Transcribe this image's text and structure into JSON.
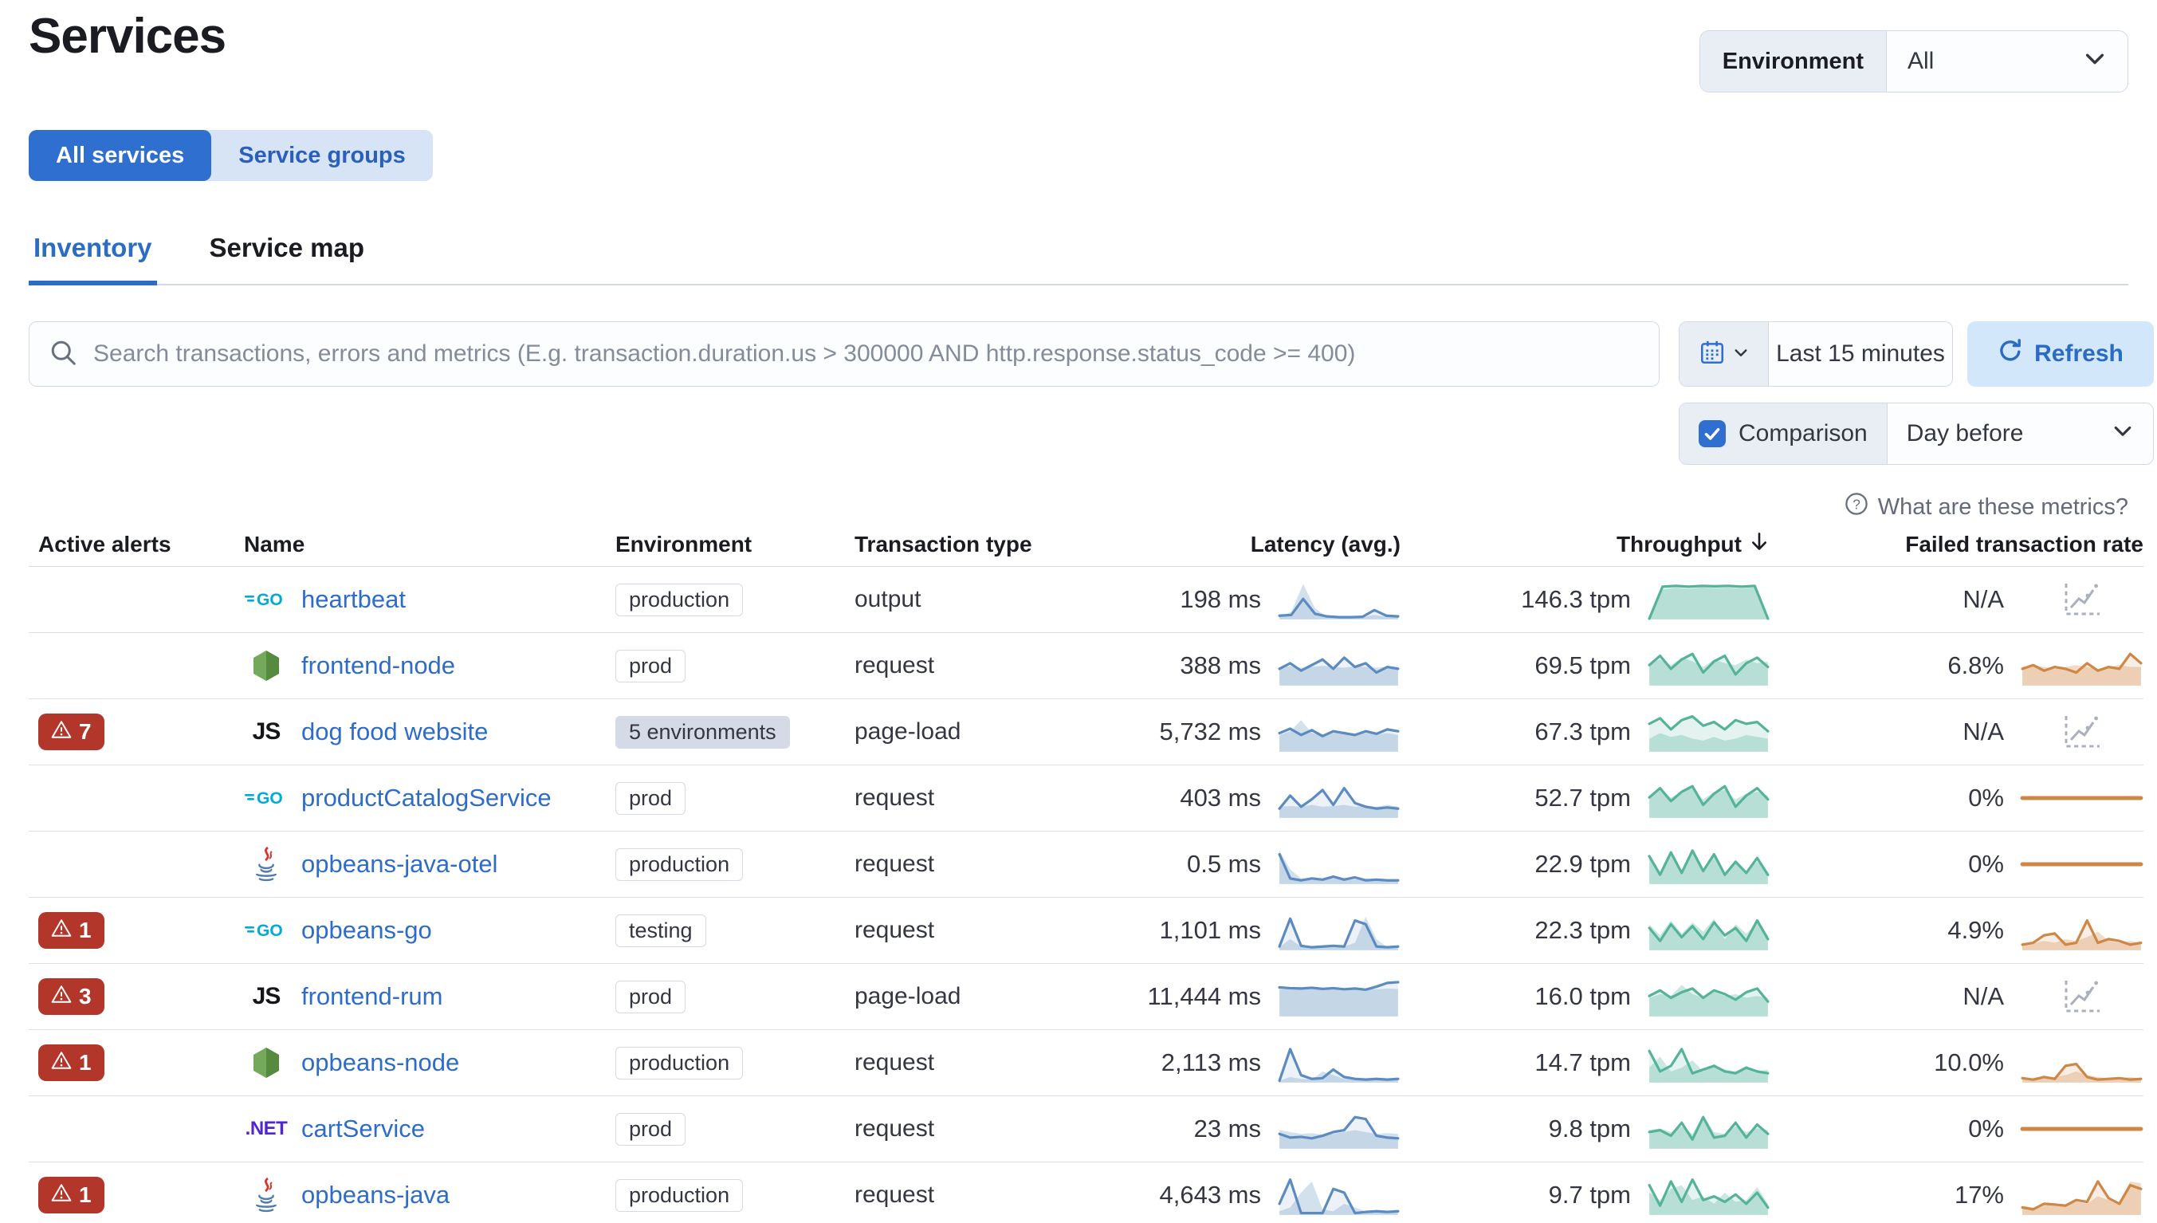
{
  "page": {
    "title": "Services"
  },
  "env_filter": {
    "label": "Environment",
    "value": "All"
  },
  "toggle": {
    "all_services": "All services",
    "service_groups": "Service groups",
    "selected": "All services"
  },
  "tabs": [
    {
      "label": "Inventory",
      "active": true
    },
    {
      "label": "Service map",
      "active": false
    }
  ],
  "search": {
    "placeholder": "Search transactions, errors and metrics (E.g. transaction.duration.us > 300000 AND http.response.status_code >= 400)"
  },
  "time_picker": {
    "range": "Last 15 minutes",
    "refresh_label": "Refresh"
  },
  "comparison": {
    "label": "Comparison",
    "checked": true,
    "value": "Day before"
  },
  "help": {
    "label": "What are these metrics?"
  },
  "table": {
    "headers": {
      "alerts": "Active alerts",
      "name": "Name",
      "environment": "Environment",
      "transaction_type": "Transaction type",
      "latency": "Latency (avg.)",
      "throughput": "Throughput",
      "failed": "Failed transaction rate"
    },
    "sorted_by": "throughput",
    "sort_direction": "desc"
  },
  "colors": {
    "primary": "#2e6fd0",
    "link": "#2e6cc9",
    "alert_badge": "#b3362a",
    "latency_line": "#5b8bc0",
    "latency_fill": "rgba(96,146,192,0.12)",
    "latency_comp_fill": "rgba(96,146,192,0.28)",
    "throughput_line": "#54b399",
    "throughput_fill": "rgba(84,179,153,0.16)",
    "throughput_comp_fill": "rgba(84,179,153,0.30)",
    "failed_line": "#cf8745",
    "failed_fill": "rgba(207,135,69,0.14)",
    "failed_comp_fill": "rgba(207,135,69,0.30)"
  },
  "rows": [
    {
      "alerts": null,
      "icon": "go",
      "name": "heartbeat",
      "environment": "production",
      "badge_style": "outline",
      "type": "output",
      "latency": "198 ms",
      "throughput": "146.3 tpm",
      "failed": "N/A",
      "sparks": {
        "latency": {
          "cur": [
            0.1,
            0.12,
            0.55,
            0.15,
            0.08,
            0.06,
            0.06,
            0.07,
            0.25,
            0.1,
            0.08
          ],
          "cmp": [
            0.08,
            0.2,
            0.95,
            0.3,
            0.07,
            0.05,
            0.05,
            0.06,
            0.12,
            0.07,
            0.05
          ]
        },
        "throughput": {
          "cur": [
            0.02,
            0.88,
            0.9,
            0.88,
            0.9,
            0.89,
            0.9,
            0.88,
            0.9,
            0.02
          ],
          "cmp": [
            0.02,
            0.8,
            0.85,
            0.82,
            0.86,
            0.84,
            0.85,
            0.83,
            0.86,
            0.02
          ]
        },
        "failed": null
      }
    },
    {
      "alerts": null,
      "icon": "node",
      "name": "frontend-node",
      "environment": "prod",
      "badge_style": "outline",
      "type": "request",
      "latency": "388 ms",
      "throughput": "69.5 tpm",
      "failed": "6.8%",
      "sparks": {
        "latency": {
          "cur": [
            0.45,
            0.6,
            0.4,
            0.55,
            0.7,
            0.45,
            0.75,
            0.5,
            0.6,
            0.35,
            0.5,
            0.45
          ],
          "cmp": [
            0.5,
            0.52,
            0.48,
            0.5,
            0.53,
            0.5,
            0.48,
            0.52,
            0.5,
            0.48,
            0.5,
            0.5
          ]
        },
        "throughput": {
          "cur": [
            0.55,
            0.8,
            0.45,
            0.7,
            0.85,
            0.35,
            0.65,
            0.8,
            0.3,
            0.6,
            0.75,
            0.5
          ],
          "cmp": [
            0.6,
            0.7,
            0.55,
            0.75,
            0.65,
            0.5,
            0.7,
            0.6,
            0.55,
            0.7,
            0.6,
            0.65
          ]
        },
        "failed": {
          "cur": [
            0.45,
            0.55,
            0.4,
            0.5,
            0.45,
            0.35,
            0.6,
            0.4,
            0.5,
            0.45,
            0.85,
            0.6
          ],
          "cmp": [
            0.5,
            0.55,
            0.5,
            0.45,
            0.5,
            0.55,
            0.5,
            0.45,
            0.5,
            0.55,
            0.5,
            0.5
          ]
        }
      }
    },
    {
      "alerts": 7,
      "icon": "js",
      "name": "dog food website",
      "environment": "5 environments",
      "badge_style": "filled",
      "type": "page-load",
      "latency": "5,732 ms",
      "throughput": "67.3 tpm",
      "failed": "N/A",
      "sparks": {
        "latency": {
          "cur": [
            0.5,
            0.62,
            0.45,
            0.58,
            0.42,
            0.55,
            0.5,
            0.45,
            0.55,
            0.48,
            0.6,
            0.55
          ],
          "cmp": [
            0.45,
            0.55,
            0.85,
            0.5,
            0.45,
            0.5,
            0.55,
            0.45,
            0.5,
            0.45,
            0.5,
            0.45
          ]
        },
        "throughput": {
          "cur": [
            0.75,
            0.9,
            0.6,
            0.85,
            0.95,
            0.7,
            0.8,
            0.6,
            0.85,
            0.75,
            0.8,
            0.55
          ],
          "cmp": [
            0.35,
            0.5,
            0.4,
            0.45,
            0.35,
            0.3,
            0.4,
            0.3,
            0.35,
            0.45,
            0.4,
            0.35
          ]
        },
        "failed": null
      }
    },
    {
      "alerts": null,
      "icon": "go",
      "name": "productCatalogService",
      "environment": "prod",
      "badge_style": "outline",
      "type": "request",
      "latency": "403 ms",
      "throughput": "52.7 tpm",
      "failed": "0%",
      "sparks": {
        "latency": {
          "cur": [
            0.25,
            0.6,
            0.3,
            0.5,
            0.75,
            0.35,
            0.8,
            0.4,
            0.3,
            0.25,
            0.28,
            0.25
          ],
          "cmp": [
            0.3,
            0.32,
            0.3,
            0.35,
            0.3,
            0.32,
            0.35,
            0.3,
            0.32,
            0.3,
            0.35,
            0.3
          ]
        },
        "throughput": {
          "cur": [
            0.55,
            0.8,
            0.45,
            0.7,
            0.85,
            0.35,
            0.65,
            0.85,
            0.3,
            0.6,
            0.8,
            0.5
          ],
          "cmp": [
            0.6,
            0.75,
            0.55,
            0.7,
            0.8,
            0.5,
            0.7,
            0.75,
            0.5,
            0.65,
            0.7,
            0.6
          ]
        },
        "failed": {
          "flat": true
        }
      }
    },
    {
      "alerts": null,
      "icon": "java",
      "name": "opbeans-java-otel",
      "environment": "production",
      "badge_style": "outline",
      "type": "request",
      "latency": "0.5 ms",
      "throughput": "22.9 tpm",
      "failed": "0%",
      "sparks": {
        "latency": {
          "cur": [
            0.8,
            0.15,
            0.1,
            0.15,
            0.12,
            0.2,
            0.12,
            0.18,
            0.1,
            0.12,
            0.1,
            0.1
          ],
          "cmp": [
            0.9,
            0.4,
            0.15,
            0.1,
            0.12,
            0.15,
            0.1,
            0.12,
            0.15,
            0.1,
            0.12,
            0.1
          ]
        },
        "throughput": {
          "cur": [
            0.75,
            0.25,
            0.85,
            0.3,
            0.9,
            0.35,
            0.8,
            0.25,
            0.6,
            0.3,
            0.7,
            0.25
          ],
          "cmp": [
            0.8,
            0.3,
            0.8,
            0.35,
            0.85,
            0.3,
            0.75,
            0.3,
            0.65,
            0.35,
            0.6,
            0.3
          ]
        },
        "failed": {
          "flat": true
        }
      }
    },
    {
      "alerts": 1,
      "icon": "go",
      "name": "opbeans-go",
      "environment": "testing",
      "badge_style": "outline",
      "type": "request",
      "latency": "1,101 ms",
      "throughput": "22.3 tpm",
      "failed": "4.9%",
      "sparks": {
        "latency": {
          "cur": [
            0.1,
            0.85,
            0.12,
            0.08,
            0.1,
            0.12,
            0.1,
            0.8,
            0.7,
            0.1,
            0.08,
            0.1
          ],
          "cmp": [
            0.08,
            0.3,
            0.1,
            0.08,
            0.1,
            0.08,
            0.1,
            0.2,
            0.9,
            0.3,
            0.08,
            0.08
          ]
        },
        "throughput": {
          "cur": [
            0.6,
            0.25,
            0.7,
            0.35,
            0.65,
            0.3,
            0.75,
            0.4,
            0.6,
            0.25,
            0.8,
            0.3
          ],
          "cmp": [
            0.7,
            0.4,
            0.8,
            0.45,
            0.75,
            0.5,
            0.85,
            0.3,
            0.7,
            0.45,
            0.75,
            0.4
          ]
        },
        "failed": {
          "cur": [
            0.15,
            0.2,
            0.4,
            0.45,
            0.15,
            0.2,
            0.8,
            0.2,
            0.3,
            0.25,
            0.15,
            0.2
          ],
          "cmp": [
            0.2,
            0.18,
            0.25,
            0.2,
            0.3,
            0.25,
            0.35,
            0.5,
            0.25,
            0.2,
            0.25,
            0.2
          ]
        }
      }
    },
    {
      "alerts": 3,
      "icon": "js",
      "name": "frontend-rum",
      "environment": "prod",
      "badge_style": "outline",
      "type": "page-load",
      "latency": "11,444 ms",
      "throughput": "16.0 tpm",
      "failed": "N/A",
      "sparks": {
        "latency": {
          "cur": [
            0.78,
            0.76,
            0.75,
            0.77,
            0.74,
            0.76,
            0.73,
            0.75,
            0.72,
            0.8,
            0.9,
            0.92
          ],
          "cmp": [
            0.72,
            0.74,
            0.73,
            0.75,
            0.72,
            0.74,
            0.73,
            0.72,
            0.74,
            0.73,
            0.75,
            0.74
          ]
        },
        "throughput": {
          "cur": [
            0.55,
            0.7,
            0.5,
            0.65,
            0.75,
            0.5,
            0.7,
            0.6,
            0.45,
            0.65,
            0.75,
            0.4
          ],
          "cmp": [
            0.5,
            0.6,
            0.55,
            0.85,
            0.6,
            0.5,
            0.65,
            0.55,
            0.6,
            0.5,
            0.55,
            0.5
          ]
        },
        "failed": null
      }
    },
    {
      "alerts": 1,
      "icon": "node",
      "name": "opbeans-node",
      "environment": "production",
      "badge_style": "outline",
      "type": "request",
      "latency": "2,113 ms",
      "throughput": "14.7 tpm",
      "failed": "10.0%",
      "sparks": {
        "latency": {
          "cur": [
            0.05,
            0.9,
            0.2,
            0.1,
            0.12,
            0.35,
            0.15,
            0.1,
            0.08,
            0.1,
            0.08,
            0.1
          ],
          "cmp": [
            0.05,
            0.15,
            0.1,
            0.08,
            0.3,
            0.2,
            0.1,
            0.08,
            0.1,
            0.08,
            0.05,
            0.08
          ]
        },
        "throughput": {
          "cur": [
            0.85,
            0.3,
            0.45,
            0.9,
            0.25,
            0.35,
            0.45,
            0.3,
            0.25,
            0.4,
            0.3,
            0.25
          ],
          "cmp": [
            0.4,
            0.7,
            0.3,
            0.4,
            0.6,
            0.3,
            0.5,
            0.35,
            0.3,
            0.45,
            0.3,
            0.35
          ]
        },
        "failed": {
          "cur": [
            0.12,
            0.08,
            0.15,
            0.1,
            0.45,
            0.5,
            0.15,
            0.08,
            0.1,
            0.12,
            0.08,
            0.1
          ],
          "cmp": [
            0.1,
            0.12,
            0.1,
            0.15,
            0.2,
            0.3,
            0.2,
            0.15,
            0.1,
            0.12,
            0.15,
            0.1
          ]
        }
      }
    },
    {
      "alerts": null,
      "icon": "dotnet",
      "name": "cartService",
      "environment": "prod",
      "badge_style": "outline",
      "type": "request",
      "latency": "23 ms",
      "throughput": "9.8 tpm",
      "failed": "0%",
      "sparks": {
        "latency": {
          "cur": [
            0.4,
            0.3,
            0.32,
            0.28,
            0.35,
            0.45,
            0.5,
            0.85,
            0.8,
            0.35,
            0.3,
            0.28
          ],
          "cmp": [
            0.5,
            0.45,
            0.4,
            0.42,
            0.38,
            0.4,
            0.45,
            0.5,
            0.45,
            0.4,
            0.42,
            0.4
          ]
        },
        "throughput": {
          "cur": [
            0.45,
            0.5,
            0.35,
            0.7,
            0.25,
            0.85,
            0.3,
            0.35,
            0.7,
            0.3,
            0.65,
            0.4
          ],
          "cmp": [
            0.5,
            0.55,
            0.45,
            0.6,
            0.4,
            0.9,
            0.45,
            0.4,
            0.6,
            0.45,
            0.55,
            0.5
          ]
        },
        "failed": {
          "flat": true
        }
      }
    },
    {
      "alerts": 1,
      "icon": "java",
      "name": "opbeans-java",
      "environment": "production",
      "badge_style": "outline",
      "type": "request",
      "latency": "4,643 ms",
      "throughput": "9.7 tpm",
      "failed": "17%",
      "sparks": {
        "latency": {
          "cur": [
            0.3,
            0.95,
            0.05,
            0.05,
            0.05,
            0.7,
            0.6,
            0.05,
            0.08,
            0.1,
            0.08,
            0.1
          ],
          "cmp": [
            0.1,
            0.2,
            0.6,
            0.9,
            0.15,
            0.1,
            0.3,
            0.2,
            0.1,
            0.12,
            0.1,
            0.08
          ]
        },
        "throughput": {
          "cur": [
            0.8,
            0.25,
            0.9,
            0.35,
            0.95,
            0.4,
            0.5,
            0.35,
            0.55,
            0.3,
            0.6,
            0.2
          ],
          "cmp": [
            0.6,
            0.4,
            0.7,
            0.8,
            0.4,
            0.5,
            0.3,
            0.6,
            0.35,
            0.4,
            0.75,
            0.3
          ]
        },
        "failed": {
          "cur": [
            0.2,
            0.15,
            0.3,
            0.28,
            0.25,
            0.4,
            0.35,
            0.9,
            0.45,
            0.3,
            0.8,
            0.7
          ],
          "cmp": [
            0.25,
            0.2,
            0.25,
            0.3,
            0.25,
            0.35,
            0.3,
            0.5,
            0.4,
            0.35,
            0.9,
            0.85
          ]
        }
      }
    }
  ]
}
